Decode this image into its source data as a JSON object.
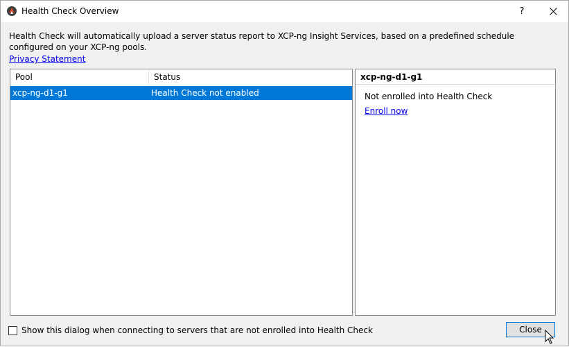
{
  "window": {
    "title": "Health Check Overview",
    "help_label": "?",
    "icons": {
      "app": "xcp-ng-icon",
      "close": "close-icon"
    }
  },
  "description": "Health Check will automatically upload a server status report to XCP-ng Insight Services, based on a predefined schedule configured on your XCP-ng pools.",
  "privacy_link": "Privacy Statement",
  "pool_list": {
    "columns": [
      "Pool",
      "Status"
    ],
    "rows": [
      {
        "pool": "xcp-ng-d1-g1",
        "status": "Health Check not enabled",
        "selected": true
      }
    ]
  },
  "details": {
    "pool_name": "xcp-ng-d1-g1",
    "status_text": "Not enrolled into Health Check",
    "enroll_link": "Enroll now"
  },
  "footer": {
    "checkbox_label": "Show this dialog when connecting to servers that are not enrolled into Health Check",
    "checkbox_checked": false,
    "close_button": "Close"
  },
  "colors": {
    "selection": "#0078d7",
    "link": "#0000ee"
  }
}
